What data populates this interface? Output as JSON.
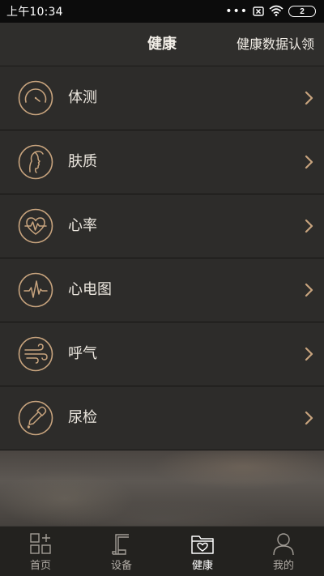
{
  "status_bar": {
    "time": "上午10:34",
    "dots": "•••",
    "battery": "2"
  },
  "header": {
    "title": "健康",
    "action": "健康数据认领"
  },
  "list": {
    "items": [
      {
        "label": "体测",
        "icon": "gauge-icon"
      },
      {
        "label": "肤质",
        "icon": "face-profile-icon"
      },
      {
        "label": "心率",
        "icon": "heart-rate-icon"
      },
      {
        "label": "心电图",
        "icon": "ecg-icon"
      },
      {
        "label": "呼气",
        "icon": "wind-icon"
      },
      {
        "label": "尿检",
        "icon": "dropper-icon"
      }
    ]
  },
  "bottom_nav": {
    "items": [
      {
        "label": "首页",
        "icon": "grid-plus-icon",
        "active": false
      },
      {
        "label": "设备",
        "icon": "device-icon",
        "active": false
      },
      {
        "label": "健康",
        "icon": "health-folder-icon",
        "active": true
      },
      {
        "label": "我的",
        "icon": "person-icon",
        "active": false
      }
    ]
  },
  "colors": {
    "accent_gold": "#c8a47e",
    "background": "#2d2c2a",
    "text": "#ece7df"
  }
}
